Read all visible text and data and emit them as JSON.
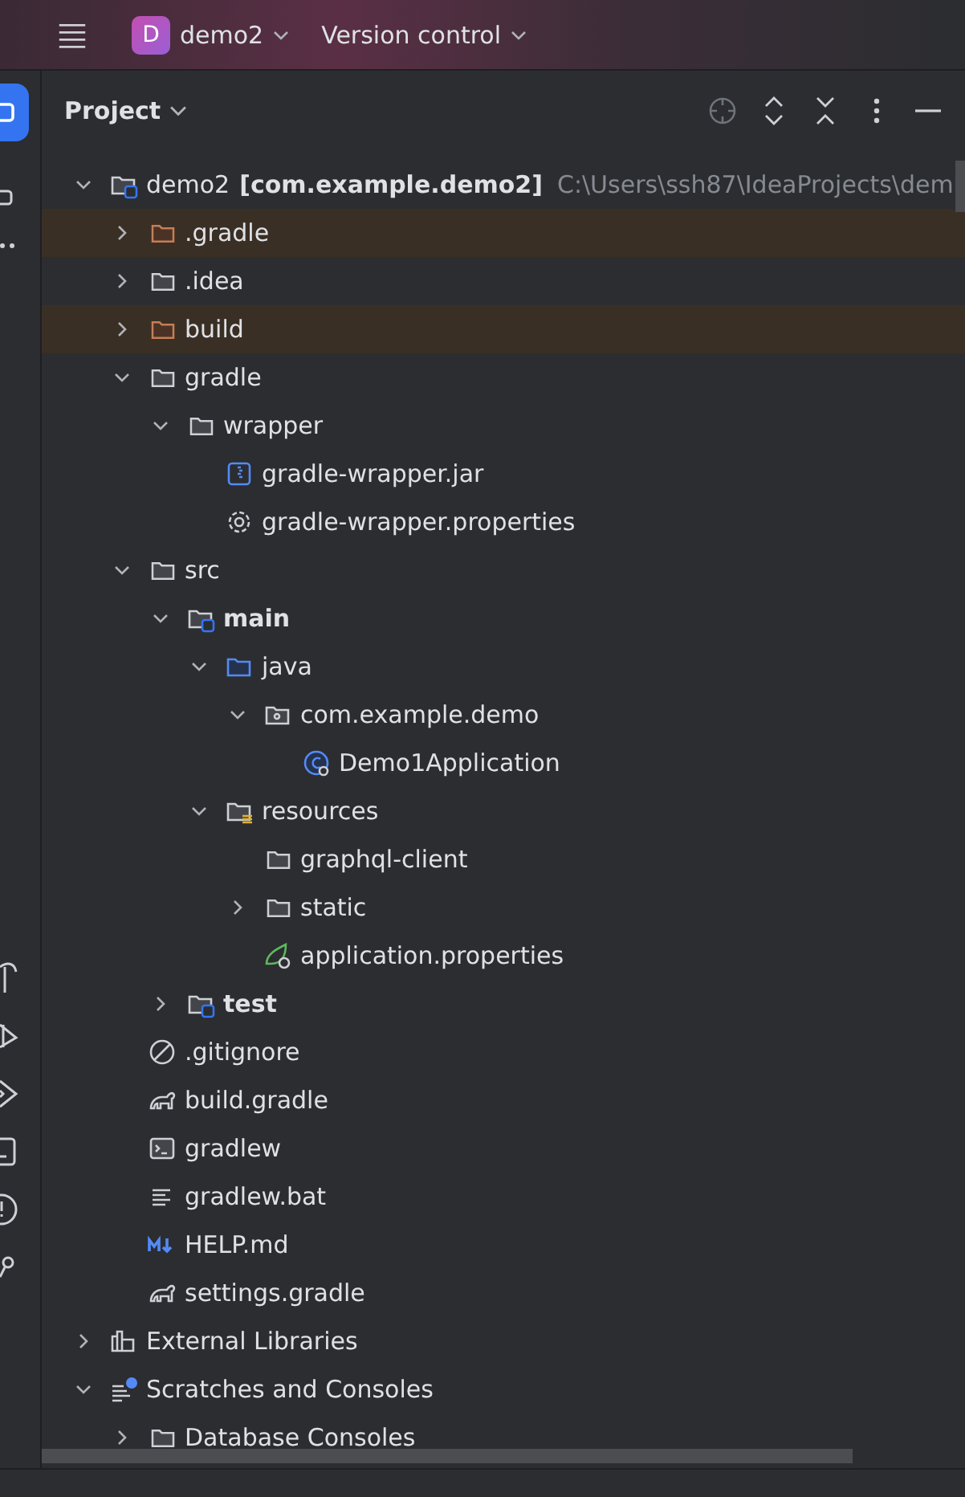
{
  "title_bar": {
    "project_badge": "D",
    "project": "demo2",
    "vcs": "Version control"
  },
  "panel": {
    "title": "Project"
  },
  "tree": [
    {
      "label": "demo2",
      "module": "[com.example.demo2]",
      "path": "C:\\Users\\ssh87\\IdeaProjects\\dem",
      "kind": "module-folder",
      "expanded": true,
      "children": [
        {
          "label": ".gradle",
          "kind": "folder",
          "excluded": true,
          "expanded": false
        },
        {
          "label": ".idea",
          "kind": "folder",
          "excluded": false,
          "expanded": false
        },
        {
          "label": "build",
          "kind": "folder",
          "excluded": true,
          "expanded": false
        },
        {
          "label": "gradle",
          "kind": "folder",
          "excluded": false,
          "expanded": true,
          "children": [
            {
              "label": "wrapper",
              "kind": "folder",
              "excluded": false,
              "expanded": true,
              "children": [
                {
                  "label": "gradle-wrapper.jar",
                  "kind": "jar"
                },
                {
                  "label": "gradle-wrapper.properties",
                  "kind": "settings"
                }
              ]
            }
          ]
        },
        {
          "label": "src",
          "kind": "folder",
          "excluded": false,
          "expanded": true,
          "children": [
            {
              "label": "main",
              "kind": "module-folder",
              "expanded": true,
              "children": [
                {
                  "label": "java",
                  "kind": "source-folder",
                  "expanded": true,
                  "children": [
                    {
                      "label": "com.example.demo",
                      "kind": "package",
                      "expanded": true,
                      "children": [
                        {
                          "label": "Demo1Application",
                          "kind": "spring-class"
                        }
                      ]
                    }
                  ]
                },
                {
                  "label": "resources",
                  "kind": "resources",
                  "expanded": true,
                  "children": [
                    {
                      "label": "graphql-client",
                      "kind": "folder",
                      "excluded": false
                    },
                    {
                      "label": "static",
                      "kind": "folder",
                      "excluded": false,
                      "expanded": false
                    },
                    {
                      "label": "application.properties",
                      "kind": "spring"
                    }
                  ]
                }
              ]
            },
            {
              "label": "test",
              "kind": "module-folder",
              "expanded": false
            }
          ]
        },
        {
          "label": ".gitignore",
          "kind": "ignore"
        },
        {
          "label": "build.gradle",
          "kind": "gradle"
        },
        {
          "label": "gradlew",
          "kind": "terminal"
        },
        {
          "label": "gradlew.bat",
          "kind": "text"
        },
        {
          "label": "HELP.md",
          "kind": "markdown"
        },
        {
          "label": "settings.gradle",
          "kind": "gradle"
        }
      ]
    },
    {
      "label": "External Libraries",
      "kind": "libraries",
      "expanded": false
    },
    {
      "label": "Scratches and Consoles",
      "kind": "scratches",
      "expanded": true,
      "children": [
        {
          "label": "Database Consoles",
          "kind": "folder",
          "excluded": false,
          "expanded": false
        }
      ]
    }
  ]
}
